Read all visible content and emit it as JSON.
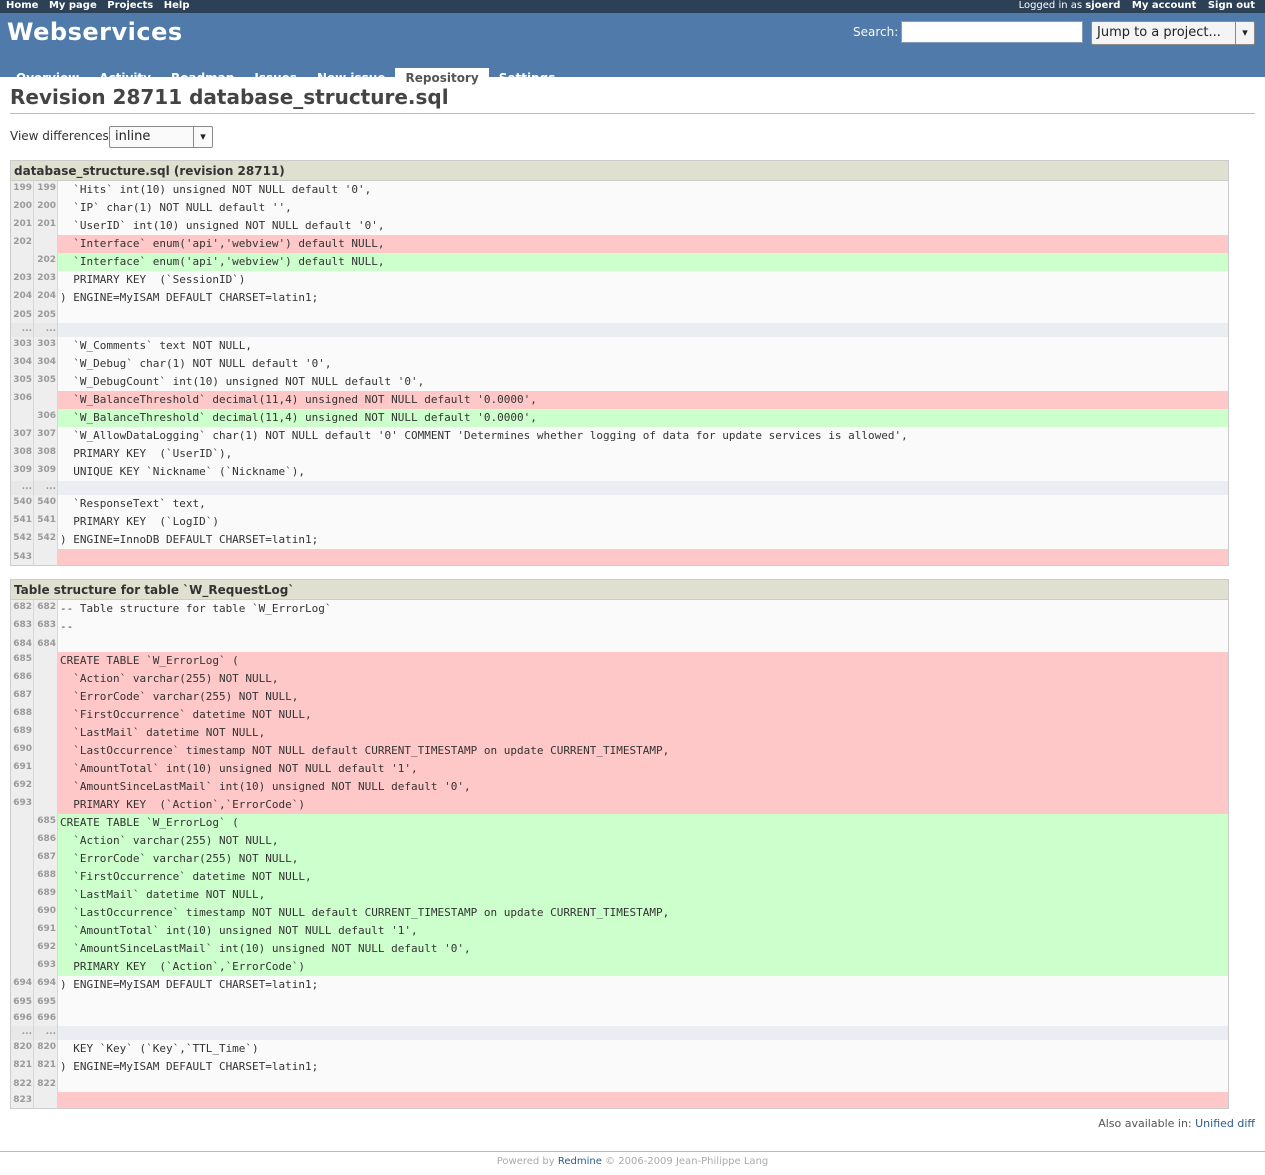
{
  "top_menu": {
    "left": [
      "Home",
      "My page",
      "Projects",
      "Help"
    ],
    "logged_as_prefix": "Logged in as",
    "logged_user": "sjoerd",
    "my_account": "My account",
    "sign_out": "Sign out"
  },
  "header": {
    "project_title": "Webservices",
    "search_label": "Search:",
    "search_value": "",
    "jump_label": "Jump to a project..."
  },
  "main_menu": [
    "Overview",
    "Activity",
    "Roadmap",
    "Issues",
    "New issue",
    "Repository",
    "Settings"
  ],
  "main_menu_selected": "Repository",
  "page": {
    "title": "Revision 28711 database_structure.sql",
    "view_differences_label": "View differences",
    "view_differences_value": "inline"
  },
  "diff_blocks": [
    {
      "header": "database_structure.sql (revision 28711)",
      "rows": [
        {
          "o": "199",
          "n": "199",
          "t": "ctx",
          "code": "  `Hits` int(10) unsigned NOT NULL default '0',"
        },
        {
          "o": "200",
          "n": "200",
          "t": "ctx",
          "code": "  `IP` char(1) NOT NULL default '',"
        },
        {
          "o": "201",
          "n": "201",
          "t": "ctx",
          "code": "  `UserID` int(10) unsigned NOT NULL default '0',"
        },
        {
          "o": "202",
          "n": "",
          "t": "out",
          "code": "  `Interface` enum('api','webview') default NULL,"
        },
        {
          "o": "",
          "n": "202",
          "t": "in",
          "code": "  `Interface` enum('api','webview') default NULL,"
        },
        {
          "o": "203",
          "n": "203",
          "t": "ctx",
          "code": "  PRIMARY KEY  (`SessionID`)"
        },
        {
          "o": "204",
          "n": "204",
          "t": "ctx",
          "code": ") ENGINE=MyISAM DEFAULT CHARSET=latin1;"
        },
        {
          "o": "205",
          "n": "205",
          "t": "short",
          "code": ""
        },
        {
          "o": "...",
          "n": "...",
          "t": "sep",
          "code": ""
        },
        {
          "o": "303",
          "n": "303",
          "t": "ctx",
          "code": "  `W_Comments` text NOT NULL,"
        },
        {
          "o": "304",
          "n": "304",
          "t": "ctx",
          "code": "  `W_Debug` char(1) NOT NULL default '0',"
        },
        {
          "o": "305",
          "n": "305",
          "t": "ctx",
          "code": "  `W_DebugCount` int(10) unsigned NOT NULL default '0',"
        },
        {
          "o": "306",
          "n": "",
          "t": "out",
          "code": "  `W_BalanceThreshold` decimal(11,4) unsigned NOT NULL default '0.0000',"
        },
        {
          "o": "",
          "n": "306",
          "t": "in",
          "code": "  `W_BalanceThreshold` decimal(11,4) unsigned NOT NULL default '0.0000',"
        },
        {
          "o": "307",
          "n": "307",
          "t": "ctx",
          "code": "  `W_AllowDataLogging` char(1) NOT NULL default '0' COMMENT 'Determines whether logging of data for update services is allowed',"
        },
        {
          "o": "308",
          "n": "308",
          "t": "ctx",
          "code": "  PRIMARY KEY  (`UserID`),"
        },
        {
          "o": "309",
          "n": "309",
          "t": "ctx",
          "code": "  UNIQUE KEY `Nickname` (`Nickname`),"
        },
        {
          "o": "...",
          "n": "...",
          "t": "sep",
          "code": ""
        },
        {
          "o": "540",
          "n": "540",
          "t": "ctx",
          "code": "  `ResponseText` text,"
        },
        {
          "o": "541",
          "n": "541",
          "t": "ctx",
          "code": "  PRIMARY KEY  (`LogID`)"
        },
        {
          "o": "542",
          "n": "542",
          "t": "ctx",
          "code": ") ENGINE=InnoDB DEFAULT CHARSET=latin1;"
        },
        {
          "o": "543",
          "n": "",
          "t": "outshort",
          "code": ""
        }
      ]
    },
    {
      "header": "Table structure for table `W_RequestLog`",
      "rows": [
        {
          "o": "682",
          "n": "682",
          "t": "ctx",
          "code": "-- Table structure for table `W_ErrorLog`"
        },
        {
          "o": "683",
          "n": "683",
          "t": "ctx",
          "code": "--"
        },
        {
          "o": "684",
          "n": "684",
          "t": "short",
          "code": ""
        },
        {
          "o": "685",
          "n": "",
          "t": "out",
          "code": "CREATE TABLE `W_ErrorLog` ("
        },
        {
          "o": "686",
          "n": "",
          "t": "out",
          "code": "  `Action` varchar(255) NOT NULL,"
        },
        {
          "o": "687",
          "n": "",
          "t": "out",
          "code": "  `ErrorCode` varchar(255) NOT NULL,"
        },
        {
          "o": "688",
          "n": "",
          "t": "out",
          "code": "  `FirstOccurrence` datetime NOT NULL,"
        },
        {
          "o": "689",
          "n": "",
          "t": "out",
          "code": "  `LastMail` datetime NOT NULL,"
        },
        {
          "o": "690",
          "n": "",
          "t": "out",
          "code": "  `LastOccurrence` timestamp NOT NULL default CURRENT_TIMESTAMP on update CURRENT_TIMESTAMP,"
        },
        {
          "o": "691",
          "n": "",
          "t": "out",
          "code": "  `AmountTotal` int(10) unsigned NOT NULL default '1',"
        },
        {
          "o": "692",
          "n": "",
          "t": "out",
          "code": "  `AmountSinceLastMail` int(10) unsigned NOT NULL default '0',"
        },
        {
          "o": "693",
          "n": "",
          "t": "out",
          "code": "  PRIMARY KEY  (`Action`,`ErrorCode`)"
        },
        {
          "o": "",
          "n": "685",
          "t": "in",
          "code": "CREATE TABLE `W_ErrorLog` ("
        },
        {
          "o": "",
          "n": "686",
          "t": "in",
          "code": "  `Action` varchar(255) NOT NULL,"
        },
        {
          "o": "",
          "n": "687",
          "t": "in",
          "code": "  `ErrorCode` varchar(255) NOT NULL,"
        },
        {
          "o": "",
          "n": "688",
          "t": "in",
          "code": "  `FirstOccurrence` datetime NOT NULL,"
        },
        {
          "o": "",
          "n": "689",
          "t": "in",
          "code": "  `LastMail` datetime NOT NULL,"
        },
        {
          "o": "",
          "n": "690",
          "t": "in",
          "code": "  `LastOccurrence` timestamp NOT NULL default CURRENT_TIMESTAMP on update CURRENT_TIMESTAMP,"
        },
        {
          "o": "",
          "n": "691",
          "t": "in",
          "code": "  `AmountTotal` int(10) unsigned NOT NULL default '1',"
        },
        {
          "o": "",
          "n": "692",
          "t": "in",
          "code": "  `AmountSinceLastMail` int(10) unsigned NOT NULL default '0',"
        },
        {
          "o": "",
          "n": "693",
          "t": "in",
          "code": "  PRIMARY KEY  (`Action`,`ErrorCode`)"
        },
        {
          "o": "694",
          "n": "694",
          "t": "ctx",
          "code": ") ENGINE=MyISAM DEFAULT CHARSET=latin1;"
        },
        {
          "o": "695",
          "n": "695",
          "t": "short",
          "code": ""
        },
        {
          "o": "696",
          "n": "696",
          "t": "short",
          "code": ""
        },
        {
          "o": "...",
          "n": "...",
          "t": "sep",
          "code": ""
        },
        {
          "o": "820",
          "n": "820",
          "t": "ctx",
          "code": "  KEY `Key` (`Key`,`TTL_Time`)"
        },
        {
          "o": "821",
          "n": "821",
          "t": "ctx",
          "code": ") ENGINE=MyISAM DEFAULT CHARSET=latin1;"
        },
        {
          "o": "822",
          "n": "822",
          "t": "short",
          "code": ""
        },
        {
          "o": "823",
          "n": "",
          "t": "outshort",
          "code": ""
        }
      ]
    }
  ],
  "other_formats": {
    "label": "Also available in:",
    "link": "Unified diff"
  },
  "footer": {
    "prefix": "Powered by",
    "link": "Redmine",
    "suffix": "© 2006-2009 Jean-Philippe Lang"
  },
  "colors": {
    "top_menu_bg": "#2c4056",
    "header_bg": "#507aaa",
    "diff_out": "#ffc8c8",
    "diff_in": "#ccffcc",
    "table_header_bg": "#e0e0d0"
  }
}
